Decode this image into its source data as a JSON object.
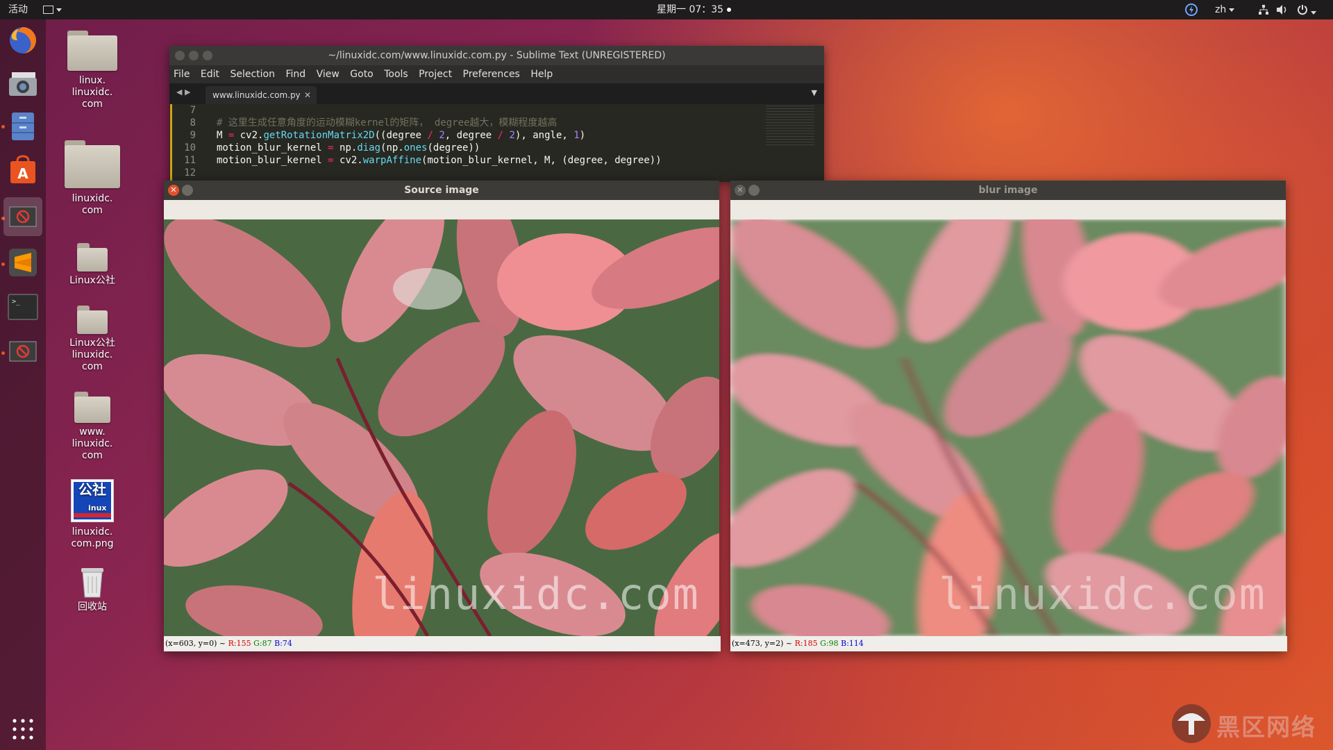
{
  "topbar": {
    "activities": "活动",
    "clock": "星期一 07：35",
    "language": "zh"
  },
  "dock": {
    "items": [
      "firefox-icon",
      "screenshot-icon",
      "files-icon",
      "software-center-icon",
      "app-icon",
      "sublime-icon",
      "terminal-icon",
      "app-icon-2"
    ]
  },
  "desktop": {
    "icons": [
      {
        "label": "linux.\nlinuxidc.\ncom"
      },
      {
        "label": "linuxidc.\ncom"
      },
      {
        "label": "Linux公社"
      },
      {
        "label": "Linux公社\nlinuxidc.\ncom"
      },
      {
        "label": "www.\nlinuxidc.\ncom"
      },
      {
        "label": "linuxidc.\ncom.png"
      },
      {
        "label": "回收站"
      }
    ],
    "png_logo_text": "公社",
    "png_logo_sub": "inux"
  },
  "sublime": {
    "title": "~/linuxidc.com/www.linuxidc.com.py - Sublime Text (UNREGISTERED)",
    "menu": [
      "File",
      "Edit",
      "Selection",
      "Find",
      "View",
      "Goto",
      "Tools",
      "Project",
      "Preferences",
      "Help"
    ],
    "tab": "www.linuxidc.com.py",
    "lines": [
      {
        "num": "7"
      },
      {
        "num": "8",
        "comment": "# 这里生成任意角度的运动模糊kernel的矩阵， degree越大，模糊程度越高"
      },
      {
        "num": "9"
      },
      {
        "num": "10"
      },
      {
        "num": "11"
      },
      {
        "num": "12"
      }
    ]
  },
  "source_window": {
    "title": "Source image",
    "status_coords": "(x=603, y=0) ~",
    "r": "R:155",
    "g": "G:87",
    "b": "B:74"
  },
  "blur_window": {
    "title": "blur image",
    "status_coords": "(x=473, y=2) ~",
    "r": "R:185",
    "g": "G:98",
    "b": "B:114"
  },
  "watermark": "linuxidc.com",
  "corner_logo": "黑区网络",
  "colors": {
    "accent": "#e95420",
    "close": "#e3522a"
  }
}
